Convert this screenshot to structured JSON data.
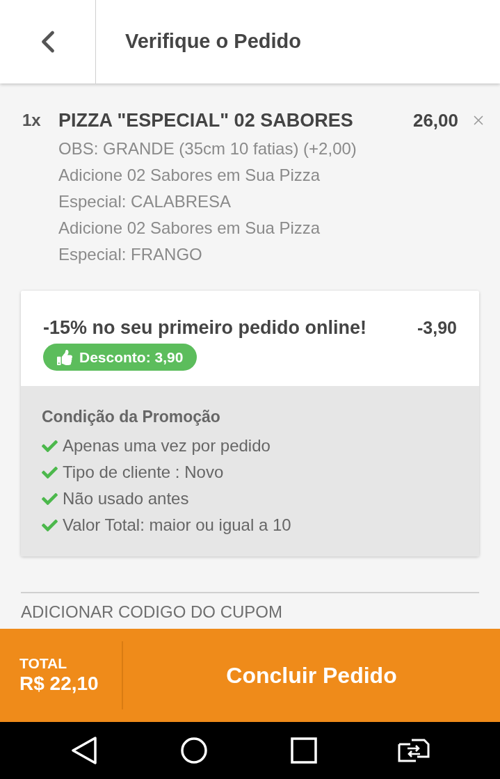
{
  "header": {
    "title": "Verifique o Pedido"
  },
  "items": [
    {
      "quantity": "1x",
      "name": "PIZZA \"ESPECIAL\" 02 SABORES",
      "price": "26,00",
      "details": [
        "OBS: GRANDE (35cm 10 fatias) (+2,00)",
        "Adicione 02 Sabores em Sua Pizza",
        "Especial: CALABRESA",
        "Adicione 02 Sabores em Sua Pizza",
        "Especial: FRANGO"
      ]
    }
  ],
  "promotion": {
    "title": "-15% no seu primeiro pedido online!",
    "amount": "-3,90",
    "badge": "Desconto: 3,90",
    "conditions_title": "Condição da Promoção",
    "conditions": [
      {
        "text": "Apenas uma vez por pedido",
        "met": true
      },
      {
        "text": "Tipo de cliente : Novo",
        "met": true
      },
      {
        "text": "Não usado antes",
        "met": true
      },
      {
        "text": "Valor Total: maior ou igual a 10",
        "met": true
      }
    ]
  },
  "coupon": {
    "label": "ADICIONAR CODIGO DO CUPOM"
  },
  "footer": {
    "total_label": "TOTAL",
    "total": "R$ 22,10",
    "button": "Concluir Pedido"
  }
}
